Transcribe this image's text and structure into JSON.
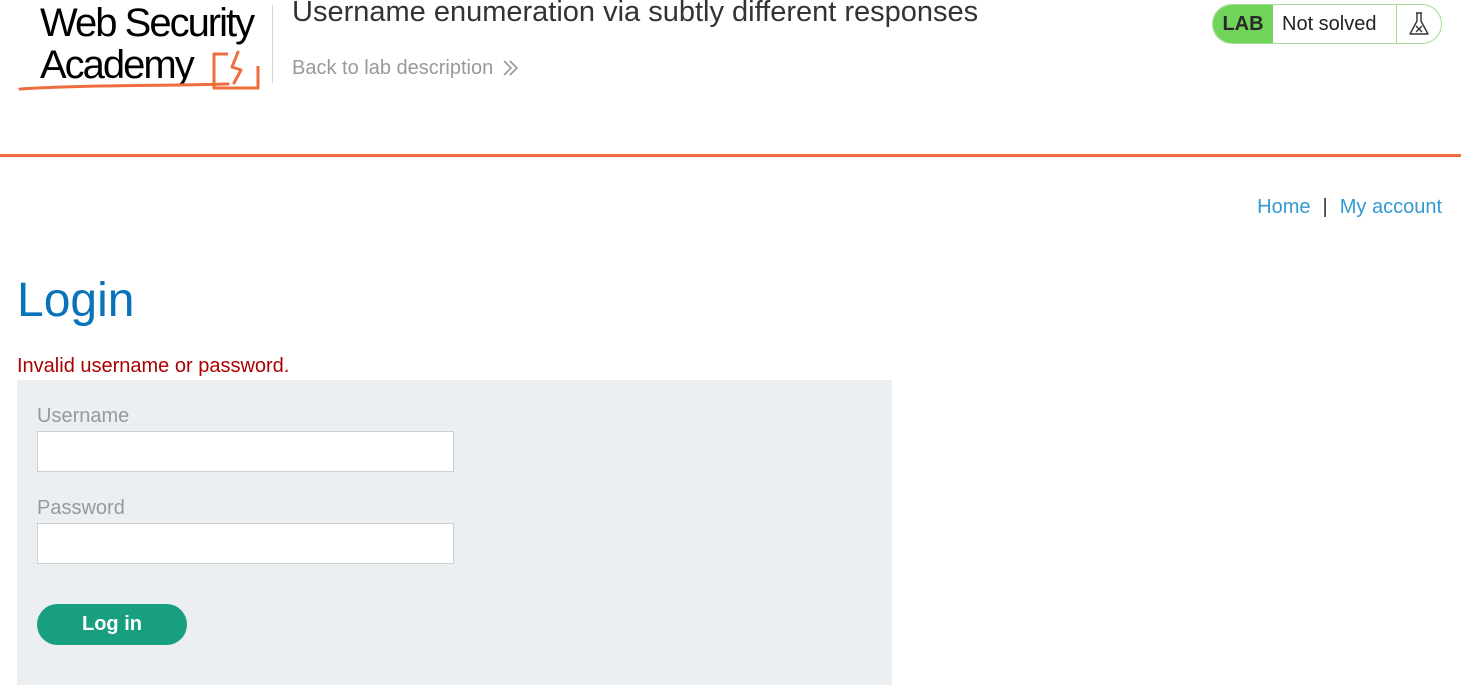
{
  "logo": {
    "line1": "Web Security",
    "line2": "Academy"
  },
  "header": {
    "lab_title": "Username enumeration via subtly different responses",
    "back_link": "Back to lab description"
  },
  "status": {
    "badge": "LAB",
    "text": "Not solved"
  },
  "nav": {
    "home": "Home",
    "separator": "|",
    "my_account": "My account"
  },
  "main": {
    "title": "Login",
    "error": "Invalid username or password."
  },
  "form": {
    "username_label": "Username",
    "username_value": "",
    "password_label": "Password",
    "password_value": "",
    "submit_label": "Log in"
  },
  "colors": {
    "accent_orange": "#ee6d3c",
    "title_blue": "#0873ba",
    "link_blue": "#3499d3",
    "error_red": "#ad0000",
    "button_green": "#179f7f",
    "lab_green": "#70d35a",
    "panel_bg": "#ebeff1"
  },
  "icons": {
    "logo_mark": "lightning-bracket-icon",
    "back": "double-chevron-right-icon",
    "status": "flask-icon"
  }
}
